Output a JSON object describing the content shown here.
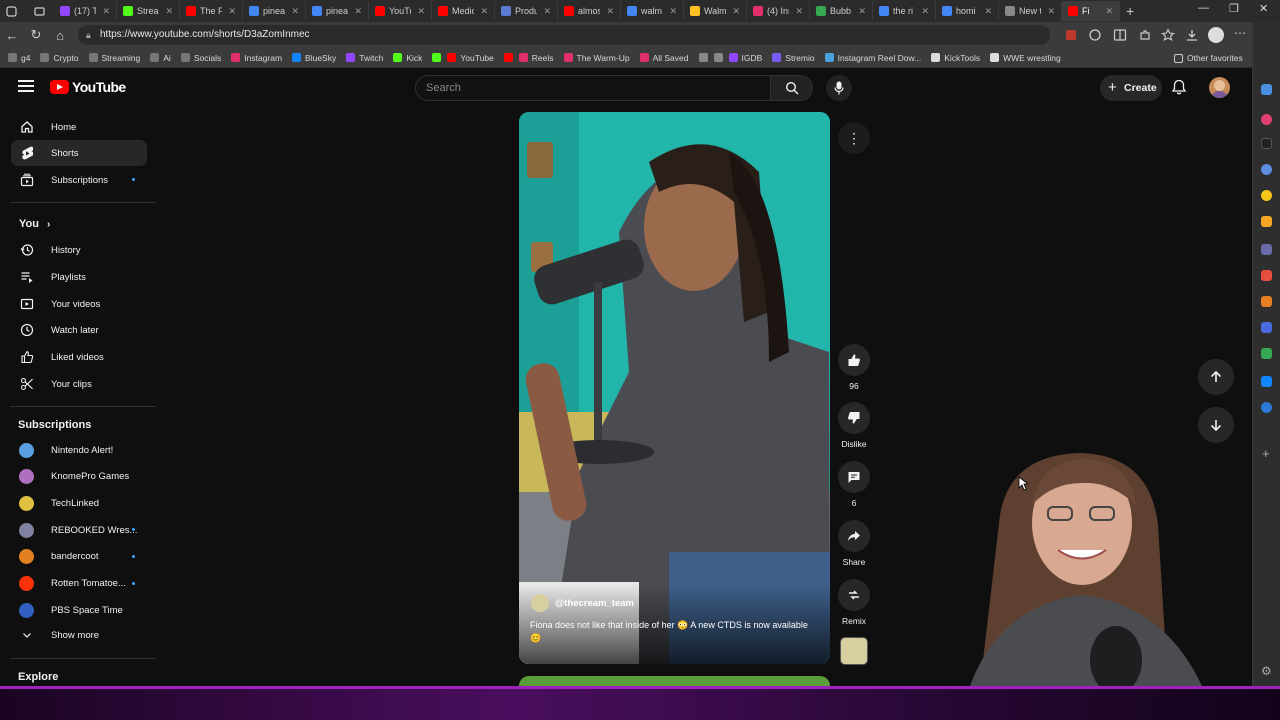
{
  "browser": {
    "tabs": [
      {
        "title": "(17) Ti",
        "color": "#9146ff"
      },
      {
        "title": "Strean",
        "color": "#53fc18"
      },
      {
        "title": "The Pl",
        "color": "#ff0000"
      },
      {
        "title": "pineap",
        "color": "#4285f4"
      },
      {
        "title": "pineap",
        "color": "#4285f4"
      },
      {
        "title": "YouTu",
        "color": "#ff0000"
      },
      {
        "title": "Medic",
        "color": "#ff0000"
      },
      {
        "title": "Produ",
        "color": "#5b7bd5"
      },
      {
        "title": "almos",
        "color": "#ff0000"
      },
      {
        "title": "walm",
        "color": "#4285f4"
      },
      {
        "title": "Walm",
        "color": "#ffc220"
      },
      {
        "title": "(4) Ins",
        "color": "#e1306c"
      },
      {
        "title": "Bubb",
        "color": "#34a853"
      },
      {
        "title": "the ri",
        "color": "#4285f4"
      },
      {
        "title": "homi",
        "color": "#4285f4"
      },
      {
        "title": "New t",
        "color": "#888888"
      },
      {
        "title": "Fi",
        "color": "#ff0000"
      }
    ],
    "url": "https://www.youtube.com/shorts/D3aZomInmec",
    "bookmarks": [
      {
        "label": "g4",
        "color": "#777777"
      },
      {
        "label": "Crypto",
        "color": "#777777"
      },
      {
        "label": "Streaming",
        "color": "#777777"
      },
      {
        "label": "Ai",
        "color": "#777777"
      },
      {
        "label": "Socials",
        "color": "#777777"
      },
      {
        "label": "Instagram",
        "color": "#e1306c"
      },
      {
        "label": "BlueSky",
        "color": "#1185fe"
      },
      {
        "label": "Twitch",
        "color": "#9146ff"
      },
      {
        "label": "Kick",
        "color": "#53fc18"
      },
      {
        "label": "",
        "color": "#53fc18"
      },
      {
        "label": "YouTube",
        "color": "#ff0000"
      },
      {
        "label": "",
        "color": "#ff0000"
      },
      {
        "label": "Reels",
        "color": "#e1306c"
      },
      {
        "label": "The Warm-Up",
        "color": "#e1306c"
      },
      {
        "label": "All Saved",
        "color": "#e1306c"
      },
      {
        "label": "",
        "color": "#888888"
      },
      {
        "label": "",
        "color": "#888888"
      },
      {
        "label": "IGDB",
        "color": "#9147ff"
      },
      {
        "label": "Stremio",
        "color": "#7b5bf5"
      },
      {
        "label": "Instagram Reel Dow...",
        "color": "#4aa3df"
      },
      {
        "label": "KickTools",
        "color": "#dddddd"
      },
      {
        "label": "WWE wrestling",
        "color": "#dddddd"
      }
    ],
    "other_favorites": "Other favorites"
  },
  "youtube": {
    "logo_text": "YouTube",
    "search_placeholder": "Search",
    "create_label": "Create",
    "sidebar": {
      "main": [
        {
          "label": "Home",
          "icon": "home-icon",
          "active": false
        },
        {
          "label": "Shorts",
          "icon": "shorts-icon",
          "active": true
        },
        {
          "label": "Subscriptions",
          "icon": "subscriptions-icon",
          "active": false,
          "dot": true
        }
      ],
      "you_label": "You",
      "you": [
        {
          "label": "History",
          "icon": "history-icon"
        },
        {
          "label": "Playlists",
          "icon": "playlists-icon"
        },
        {
          "label": "Your videos",
          "icon": "your-videos-icon"
        },
        {
          "label": "Watch later",
          "icon": "watch-later-icon"
        },
        {
          "label": "Liked videos",
          "icon": "liked-videos-icon"
        },
        {
          "label": "Your clips",
          "icon": "clips-icon"
        }
      ],
      "subscriptions_label": "Subscriptions",
      "subscriptions": [
        {
          "label": "Nintendo Alert!",
          "color": "#5aa0e0",
          "dot": false
        },
        {
          "label": "KnomePro Games",
          "color": "#b070c0",
          "dot": false
        },
        {
          "label": "TechLinked",
          "color": "#e0c040",
          "dot": false
        },
        {
          "label": "REBOOKED Wres...",
          "color": "#8080a0",
          "dot": true
        },
        {
          "label": "bandercoot",
          "color": "#e08020",
          "dot": true
        },
        {
          "label": "Rotten Tomatoe...",
          "color": "#fa320a",
          "dot": true
        },
        {
          "label": "PBS Space Time",
          "color": "#3060c0",
          "dot": false
        }
      ],
      "show_more": "Show more",
      "explore_label": "Explore"
    },
    "short": {
      "channel": "@thecream_team",
      "title": "Fiona does not like that inside of her 😳 A new CTDS is now available 😊",
      "likes": "96",
      "dislike_label": "Dislike",
      "comments": "6",
      "share_label": "Share",
      "remix_label": "Remix"
    }
  }
}
